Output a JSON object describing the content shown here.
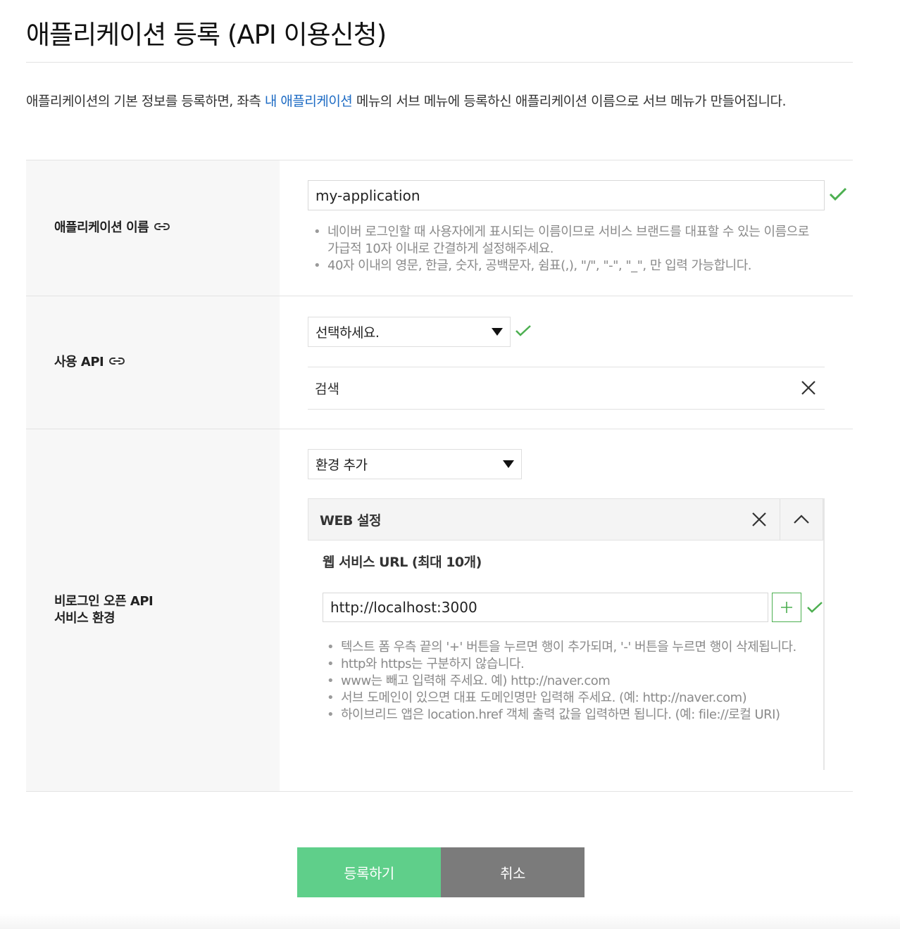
{
  "page": {
    "title": "애플리케이션 등록 (API 이용신청)",
    "intro_before": "애플리케이션의 기본 정보를 등록하면, 좌측 ",
    "intro_link": "내 애플리케이션",
    "intro_after": " 메뉴의 서브 메뉴에 등록하신 애플리케이션 이름으로 서브 메뉴가 만들어집니다."
  },
  "app_name": {
    "label": "애플리케이션 이름",
    "value": "my-application",
    "help": [
      "네이버 로그인할 때 사용자에게 표시되는 이름이므로 서비스 브랜드를 대표할 수 있는 이름으로 가급적 10자 이내로 간결하게 설정해주세요.",
      "40자 이내의 영문, 한글, 숫자, 공백문자, 쉼표(,), \"/\", \"-\", \"_\", 만 입력 가능합니다."
    ]
  },
  "api": {
    "label": "사용 API",
    "select_value": "선택하세요.",
    "selected_item": "검색"
  },
  "env": {
    "label_line1": "비로그인 오픈 API",
    "label_line2": "서비스 환경",
    "select_value": "환경 추가",
    "web_title": "WEB 설정",
    "url_label": "웹 서비스 URL (최대 10개)",
    "url_value": "http://localhost:3000",
    "help": [
      "텍스트 폼 우측 끝의 '+' 버튼을 누르면 행이 추가되며, '-' 버튼을 누르면 행이 삭제됩니다.",
      "http와 https는 구분하지 않습니다.",
      "www는 빼고 입력해 주세요. 예) http://naver.com",
      "서브 도메인이 있으면 대표 도메인명만 입력해 주세요. (예: http://naver.com)",
      "하이브리드 앱은 location.href 객체 출력 값을 입력하면 됩니다. (예: file://로컬 URI)"
    ]
  },
  "buttons": {
    "register": "등록하기",
    "cancel": "취소"
  },
  "colors": {
    "accent_link": "#1d6bc4",
    "check_green": "#4caf50",
    "register_button": "#5fcf8a",
    "cancel_button": "#7b7b7b"
  }
}
